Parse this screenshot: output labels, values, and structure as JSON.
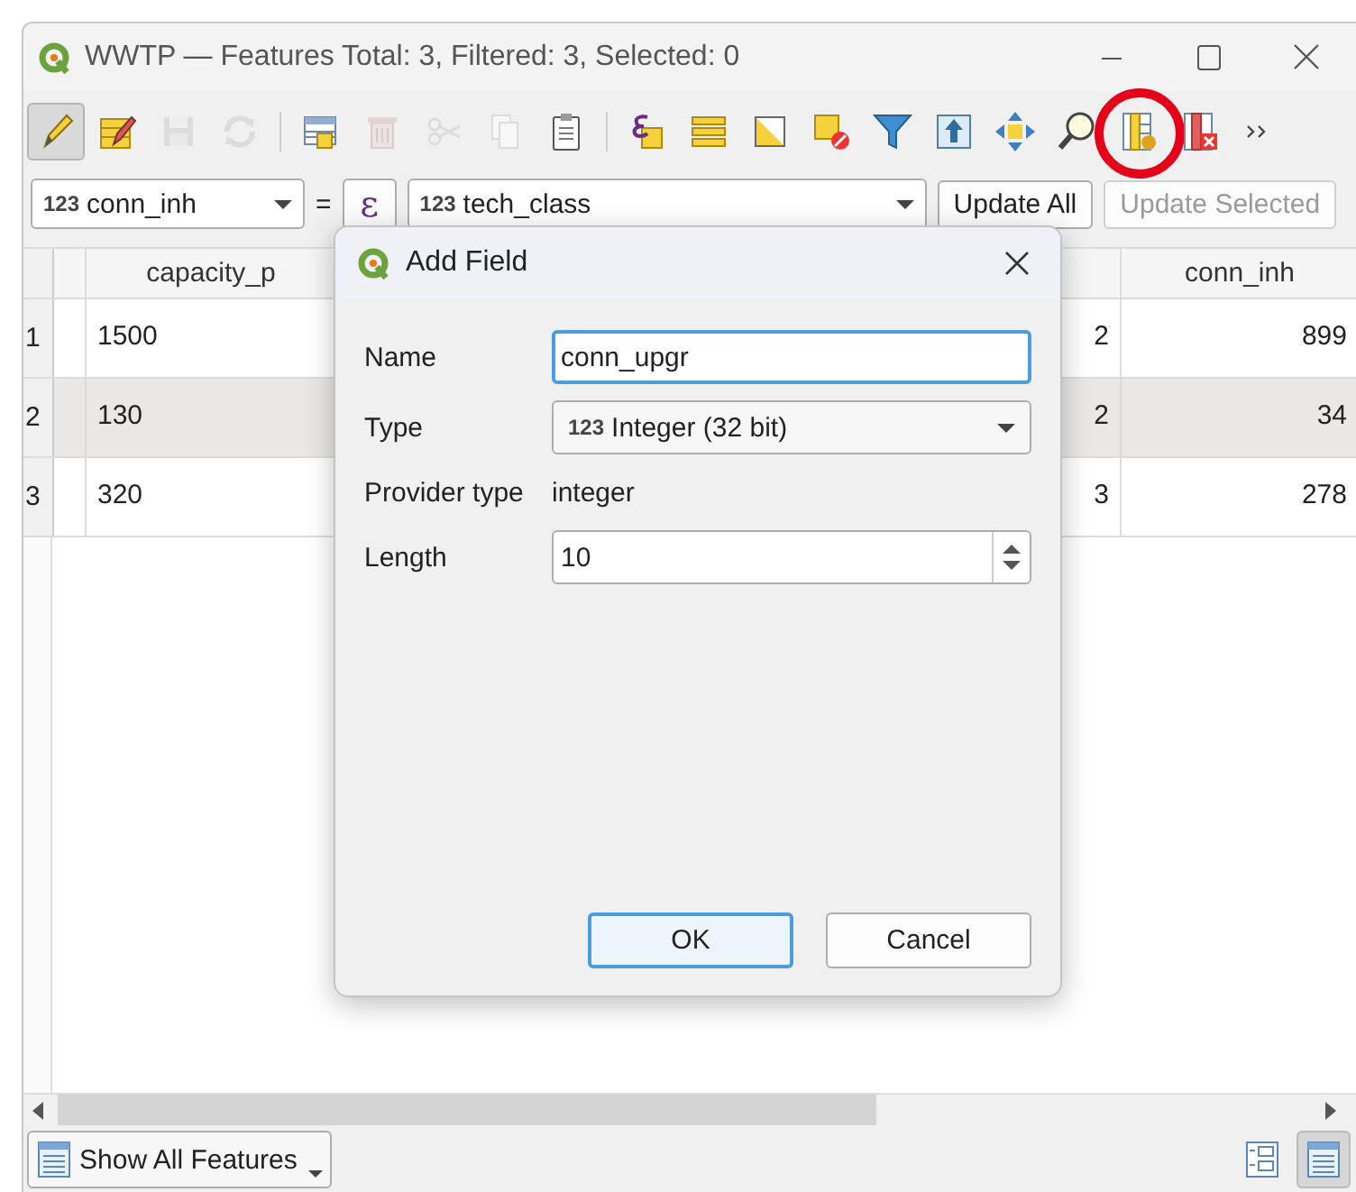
{
  "window": {
    "title": "WWTP — Features Total: 3, Filtered: 3, Selected: 0"
  },
  "toolbar": [
    {
      "kind": "pencil",
      "pressed": true,
      "disabled": false
    },
    {
      "kind": "multiedit",
      "pressed": false,
      "disabled": false
    },
    {
      "kind": "save",
      "pressed": false,
      "disabled": true
    },
    {
      "kind": "reload",
      "pressed": false,
      "disabled": true
    },
    {
      "kind": "separator"
    },
    {
      "kind": "addrow",
      "pressed": false,
      "disabled": false
    },
    {
      "kind": "trash",
      "pressed": false,
      "disabled": true
    },
    {
      "kind": "scissors",
      "pressed": false,
      "disabled": true
    },
    {
      "kind": "copy",
      "pressed": false,
      "disabled": true
    },
    {
      "kind": "paste",
      "pressed": false,
      "disabled": false
    },
    {
      "kind": "separator"
    },
    {
      "kind": "epsilon",
      "pressed": false,
      "disabled": false
    },
    {
      "kind": "bars",
      "pressed": false,
      "disabled": false
    },
    {
      "kind": "invert",
      "pressed": false,
      "disabled": false
    },
    {
      "kind": "deselect",
      "pressed": false,
      "disabled": false
    },
    {
      "kind": "funnel",
      "pressed": false,
      "disabled": false
    },
    {
      "kind": "totop",
      "pressed": false,
      "disabled": false
    },
    {
      "kind": "pan",
      "pressed": false,
      "disabled": false
    },
    {
      "kind": "zoom",
      "pressed": false,
      "disabled": false
    },
    {
      "kind": "newfield",
      "pressed": false,
      "disabled": false,
      "highlighted": true
    },
    {
      "kind": "delfield",
      "pressed": false,
      "disabled": false
    },
    {
      "kind": "more",
      "pressed": false,
      "disabled": false
    }
  ],
  "field_bar": {
    "field": "conn_inh",
    "field_type": "123",
    "equals": "=",
    "expression": "ε",
    "value_type": "123",
    "value": "tech_class",
    "buttons": [
      {
        "label": "Update All",
        "disabled": false
      },
      {
        "label": "Update Selected",
        "disabled": true
      }
    ]
  },
  "table": {
    "columns": [
      {
        "label": "capacity_p"
      },
      {},
      {
        "label": "conn_inh"
      }
    ],
    "rows": [
      {
        "number": "1",
        "cells": [
          "1500",
          "2",
          "899"
        ]
      },
      {
        "number": "2",
        "cells": [
          "130",
          "2",
          "34"
        ]
      },
      {
        "number": "3",
        "cells": [
          "320",
          "3",
          "278"
        ]
      }
    ]
  },
  "footer": {
    "filter": "Show All Features",
    "views": [
      {
        "kind": "form",
        "selected": false
      },
      {
        "kind": "table",
        "selected": true
      }
    ]
  },
  "dialog": {
    "title": "Add Field",
    "fields": [
      {
        "kind": "text",
        "label": "Name",
        "value": "conn_upgr"
      },
      {
        "kind": "combo",
        "label": "Type",
        "type_badge": "123",
        "value": "Integer (32 bit)"
      },
      {
        "kind": "static",
        "label": "Provider type",
        "value": "integer"
      },
      {
        "kind": "spin",
        "label": "Length",
        "value": "10"
      }
    ],
    "buttons": [
      {
        "label": "OK",
        "default": true
      },
      {
        "label": "Cancel",
        "default": false
      }
    ]
  }
}
